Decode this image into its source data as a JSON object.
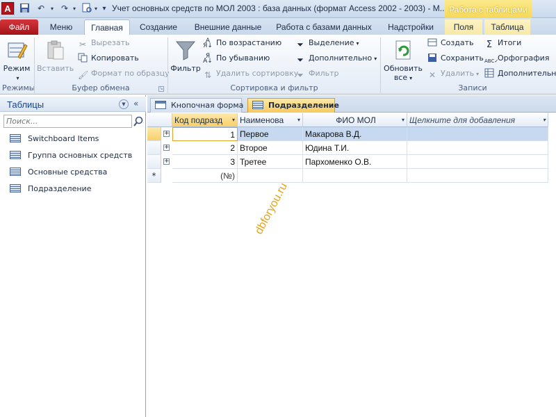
{
  "titlebar": {
    "app_letter": "A",
    "title": "Учет основных средств по МОЛ 2003 : база данных (формат Access 2002 - 2003)  -  M...",
    "context_header": "Работа с таблицами"
  },
  "ribbon_tabs": [
    {
      "label": "Файл"
    },
    {
      "label": "Меню"
    },
    {
      "label": "Главная"
    },
    {
      "label": "Создание"
    },
    {
      "label": "Внешние данные"
    },
    {
      "label": "Работа с базами данных"
    },
    {
      "label": "Надстройки"
    },
    {
      "label": "Поля"
    },
    {
      "label": "Таблица"
    }
  ],
  "ribbon": {
    "modes": {
      "view_label": "Режим",
      "group_label": "Режимы"
    },
    "clipboard": {
      "paste_label": "Вставить",
      "cut_label": "Вырезать",
      "copy_label": "Копировать",
      "format_painter_label": "Формат по образцу",
      "group_label": "Буфер обмена"
    },
    "sort_filter": {
      "filter_label": "Фильтр",
      "ascending_label": "По возрастанию",
      "descending_label": "По убыванию",
      "remove_sort_label": "Удалить сортировку",
      "selection_label": "Выделение",
      "advanced_label": "Дополнительно",
      "toggle_filter_label": "Фильтр",
      "group_label": "Сортировка и фильтр"
    },
    "records": {
      "refresh_label_1": "Обновить",
      "refresh_label_2": "все",
      "new_label": "Создать",
      "save_label": "Сохранить",
      "delete_label": "Удалить",
      "totals_label": "Итоги",
      "spelling_label": "Орфография",
      "more_label": "Дополнительно",
      "group_label": "Записи"
    }
  },
  "nav": {
    "title": "Таблицы",
    "search_placeholder": "Поиск...",
    "items": [
      {
        "label": "Switchboard Items"
      },
      {
        "label": "Группа основных средств"
      },
      {
        "label": "Основные средства"
      },
      {
        "label": "Подразделение"
      }
    ]
  },
  "doc_tabs": [
    {
      "label": "Кнопочная форма"
    },
    {
      "label": "Подразделение"
    }
  ],
  "grid": {
    "columns": [
      {
        "label": "Код подразд"
      },
      {
        "label": "Наименова"
      },
      {
        "label": "ФИО МОЛ"
      },
      {
        "label": "Щелкните для добавления"
      }
    ],
    "rows": [
      {
        "code": "1",
        "name": "Первое",
        "mol": "Макарова В.Д."
      },
      {
        "code": "2",
        "name": "Второе",
        "mol": "Юдина Т.И."
      },
      {
        "code": "3",
        "name": "Третее",
        "mol": "Пархоменко О.В."
      }
    ],
    "new_row_selector": "*",
    "new_row_code": "(№)"
  },
  "watermark": "dbforyou.ru",
  "colors": {
    "file_tab": "#b5121b",
    "context_header": "#f6d85a",
    "active_doc_tab": "#f7c95d",
    "selected_row": "#c7d9f0"
  }
}
